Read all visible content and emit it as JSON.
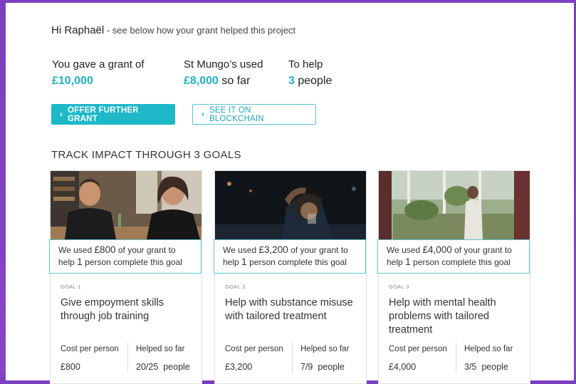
{
  "greeting": {
    "name": "Hi Raphaël",
    "rest": " - see below how your grant helped this project"
  },
  "stats": [
    {
      "label": "You gave a grant of",
      "value_main": "£10,000",
      "value_rest": ""
    },
    {
      "label": "St Mungo’s used",
      "value_main": "£8,000",
      "value_rest": " so far"
    },
    {
      "label": "To help",
      "value_main": "3",
      "value_rest": " people"
    }
  ],
  "buttons": {
    "offer": "OFFER FURTHER GRANT",
    "blockchain": "SEE IT ON BLOCKCHAIN"
  },
  "section_title": "TRACK IMPACT THROUGH 3 GOALS",
  "colors": {
    "accent": "#1eb8c8",
    "background": "#8a44c9"
  },
  "cards": [
    {
      "used_prefix": "We used ",
      "used_amount": "£800",
      "used_mid": " of your grant to",
      "help_prefix": "help ",
      "help_count": "1",
      "help_suffix": " person complete this goal",
      "goal_label": "GOAL 1",
      "goal_title": "Give empoyment skills through job training",
      "cost_label": "Cost per person",
      "cost_value": "£800",
      "helped_label": "Helped so far",
      "helped_value": "20/25",
      "helped_unit": "people"
    },
    {
      "used_prefix": "We used ",
      "used_amount": "£3,200",
      "used_mid": " of your grant to",
      "help_prefix": "help ",
      "help_count": "1",
      "help_suffix": " person complete this goal",
      "goal_label": "GOAL 2",
      "goal_title": "Help with substance misuse with tailored treatment",
      "cost_label": "Cost per person",
      "cost_value": "£3,200",
      "helped_label": "Helped so far",
      "helped_value": "7/9",
      "helped_unit": "people"
    },
    {
      "used_prefix": "We used ",
      "used_amount": "£4,000",
      "used_mid": " of your grant to",
      "help_prefix": "help ",
      "help_count": "1",
      "help_suffix": " person complete this goal",
      "goal_label": "GOAL 3",
      "goal_title": "Help with mental health problems with tailored treatment",
      "cost_label": "Cost per person",
      "cost_value": "£4,000",
      "helped_label": "Helped so far",
      "helped_value": "3/5",
      "helped_unit": "people"
    }
  ]
}
